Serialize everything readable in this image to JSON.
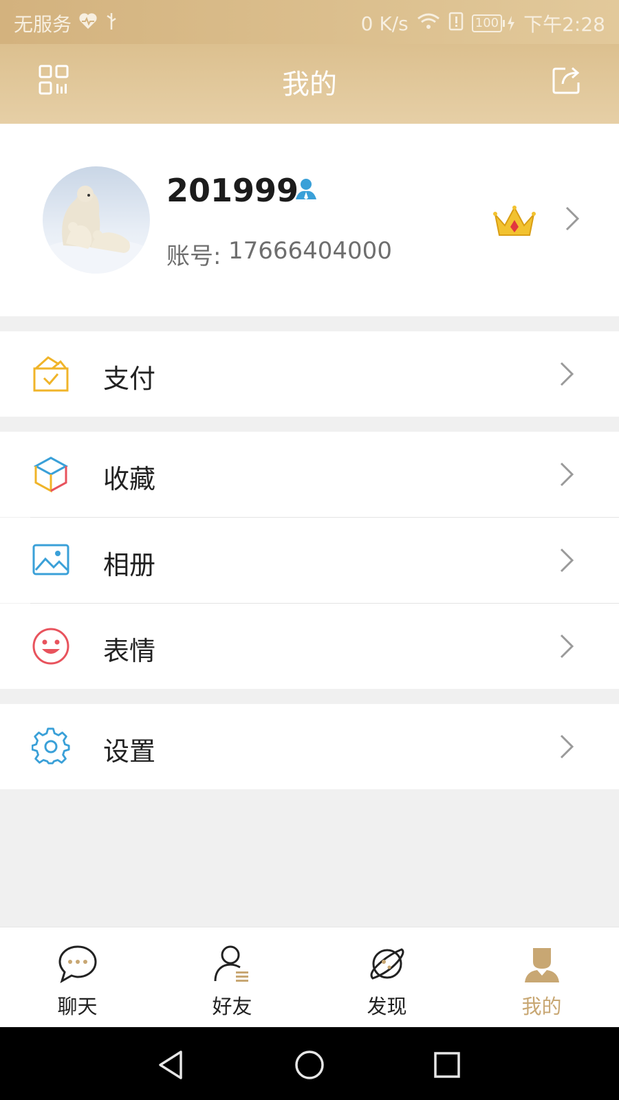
{
  "status_bar": {
    "carrier": "无服务",
    "net_speed": "0 K/s",
    "battery": "100",
    "time": "下午2:28"
  },
  "header": {
    "title": "我的"
  },
  "profile": {
    "username": "201999",
    "account_label": "账号:",
    "account_number": "17666404000"
  },
  "menu": [
    {
      "label": "支付",
      "icon": "wallet-check-icon"
    },
    {
      "label": "收藏",
      "icon": "cube-icon"
    },
    {
      "label": "相册",
      "icon": "image-icon"
    },
    {
      "label": "表情",
      "icon": "smile-icon"
    },
    {
      "label": "设置",
      "icon": "gear-icon"
    }
  ],
  "tabs": [
    {
      "label": "聊天",
      "icon": "chat-bubble-icon",
      "active": false
    },
    {
      "label": "好友",
      "icon": "contacts-icon",
      "active": false
    },
    {
      "label": "发现",
      "icon": "planet-icon",
      "active": false
    },
    {
      "label": "我的",
      "icon": "profile-icon",
      "active": true
    }
  ],
  "colors": {
    "header_gold": "#dcc08f",
    "active_tab": "#c8a773",
    "pay_icon": "#f0b429",
    "gear_icon": "#3aa0d8",
    "smile_icon": "#e8535d"
  }
}
